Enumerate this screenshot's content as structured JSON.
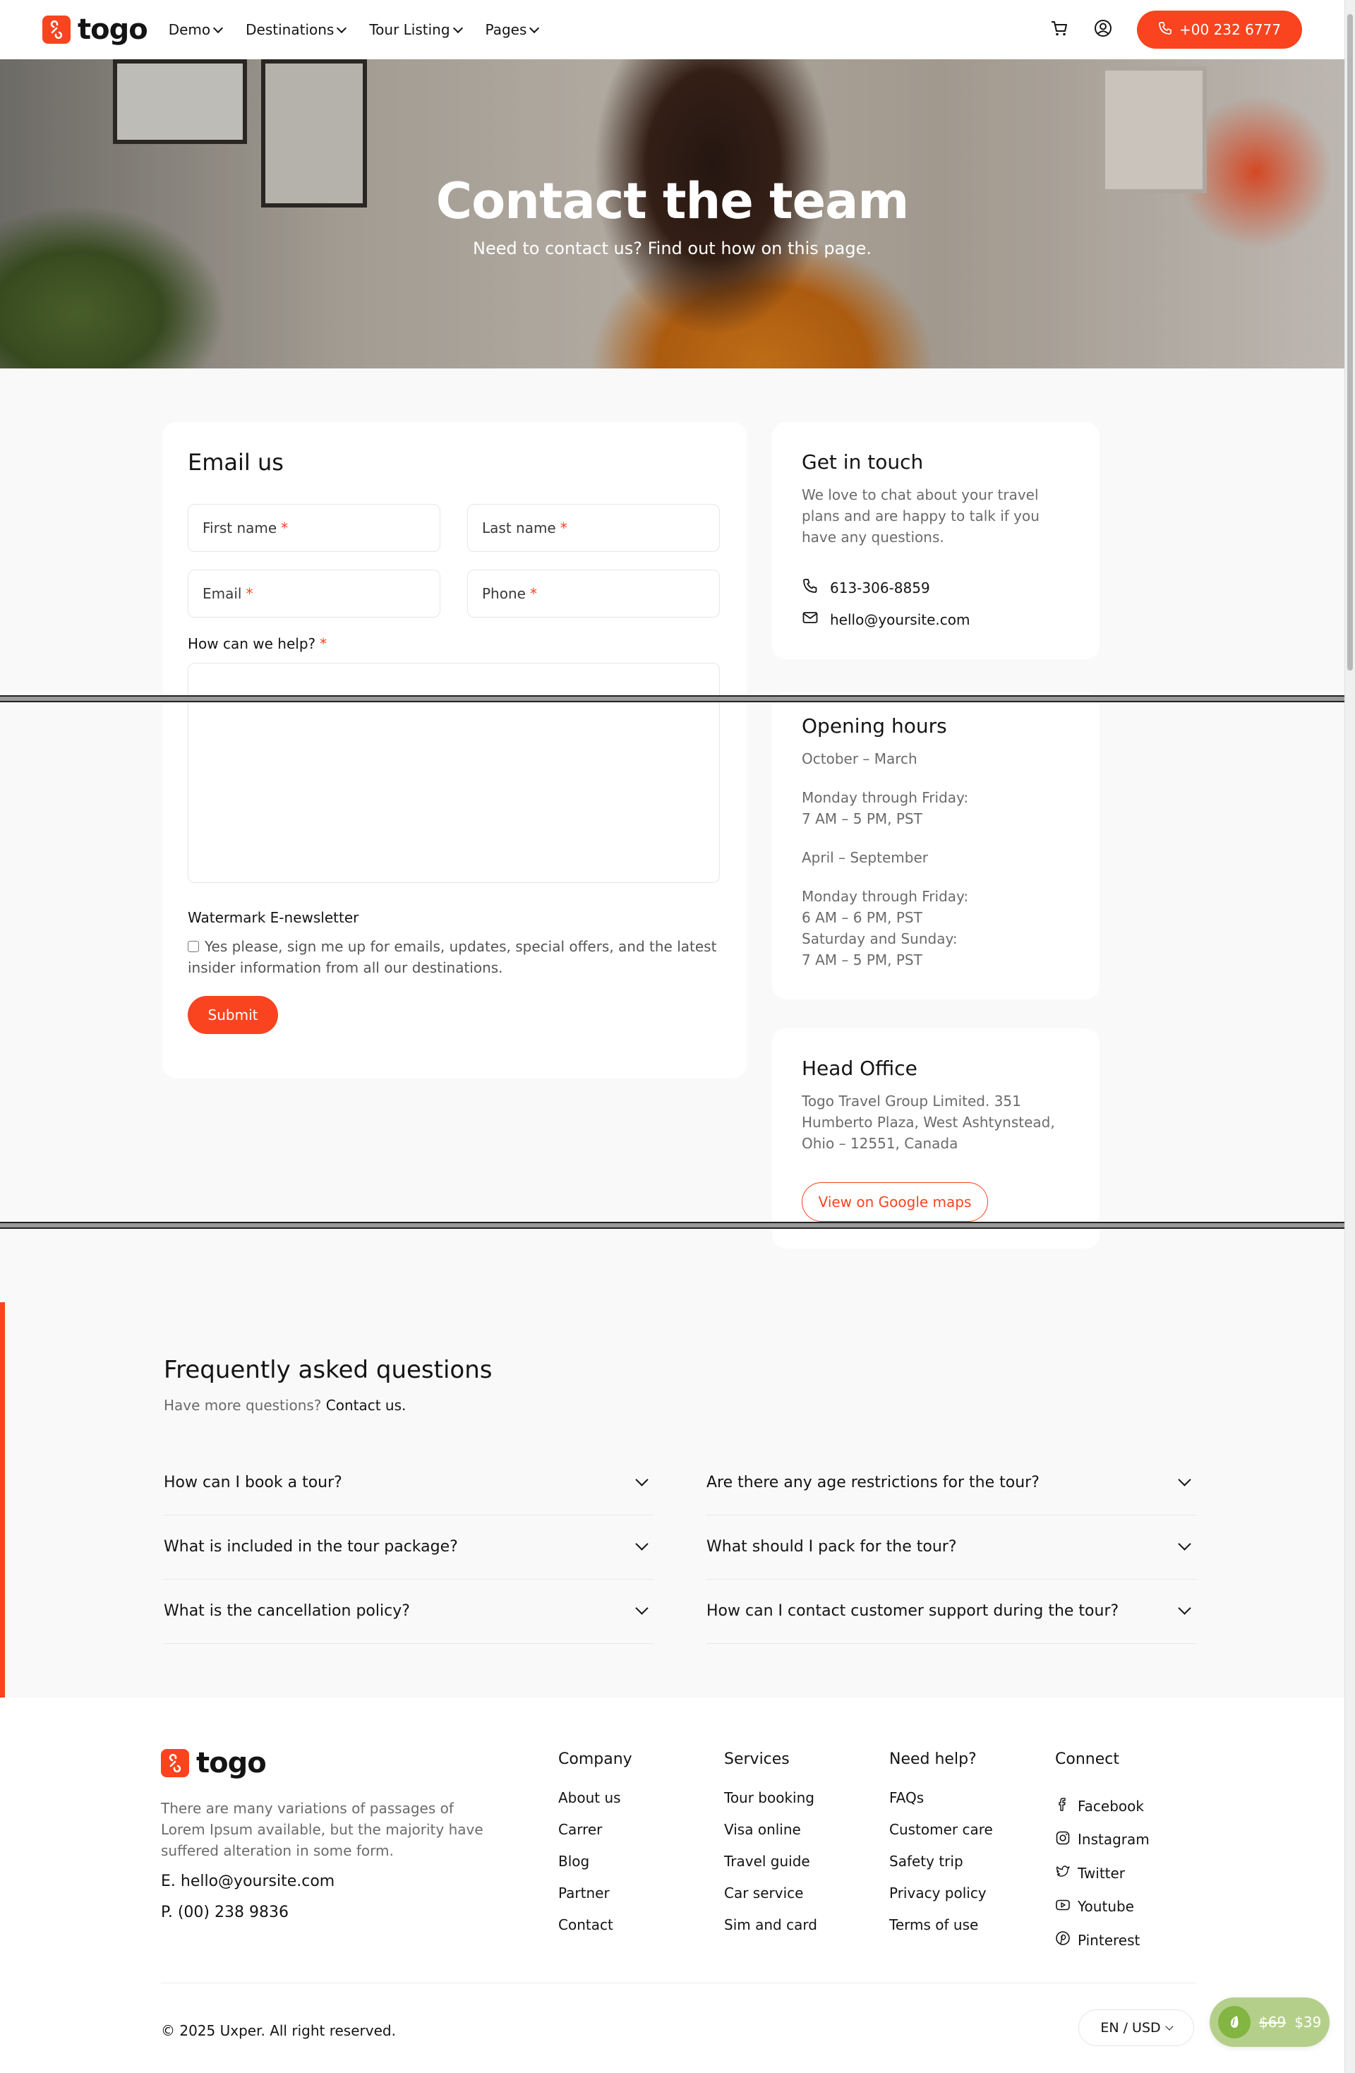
{
  "header": {
    "logo_text": "togo",
    "nav": [
      {
        "label": "Demo"
      },
      {
        "label": "Destinations"
      },
      {
        "label": "Tour Listing"
      },
      {
        "label": "Pages"
      }
    ],
    "phone_label": "+00 232 6777"
  },
  "hero": {
    "title": "Contact the team",
    "subtitle": "Need to contact us? Find out how on this page."
  },
  "email_form": {
    "title": "Email us",
    "first_name": "First name",
    "last_name": "Last name",
    "email": "Email",
    "phone": "Phone",
    "required_mark": "*",
    "help_label": "How can we help?",
    "newsletter_title": "Watermark E-newsletter",
    "newsletter_text": "Yes please, sign me up for emails, updates, special offers, and the latest insider information from all our destinations.",
    "submit": "Submit"
  },
  "get_in_touch": {
    "title": "Get in touch",
    "text": "We love to chat about your travel plans and are happy to talk if you have any questions.",
    "phone": "613-306-8859",
    "email": "hello@yoursite.com"
  },
  "opening_hours": {
    "title": "Opening hours",
    "lines": [
      "October – March",
      "Monday through Friday:",
      "7 AM – 5 PM, PST",
      "April – September",
      "Monday through Friday:",
      "6 AM – 6 PM, PST",
      "Saturday and Sunday:",
      "7 AM – 5 PM, PST"
    ]
  },
  "head_office": {
    "title": "Head Office",
    "address": "Togo Travel Group Limited. 351 Humberto Plaza, West Ashtynstead, Ohio – 12551, Canada",
    "map_button": "View on Google maps"
  },
  "faq": {
    "title": "Frequently asked questions",
    "subtitle": "Have more questions?",
    "contact_link": "Contact us.",
    "questions": [
      "How can I book a tour?",
      "Are there any age restrictions for the tour?",
      "What is included in the tour package?",
      "What should I pack for the tour?",
      "What is the cancellation policy?",
      "How can I contact customer support during the tour?"
    ]
  },
  "footer": {
    "logo_text": "togo",
    "description": "There are many variations of passages of Lorem Ipsum available, but the majority have suffered alteration in some form.",
    "email": "E. hello@yoursite.com",
    "phone": "P. (00) 238 9836",
    "columns": [
      {
        "title": "Company",
        "links": [
          "About us",
          "Carrer",
          "Blog",
          "Partner",
          "Contact"
        ]
      },
      {
        "title": "Services",
        "links": [
          "Tour booking",
          "Visa online",
          "Travel guide",
          "Car service",
          "Sim and card"
        ]
      },
      {
        "title": "Need help?",
        "links": [
          "FAQs",
          "Customer care",
          "Safety trip",
          "Privacy policy",
          "Terms of use"
        ]
      }
    ],
    "connect": {
      "title": "Connect",
      "links": [
        "Facebook",
        "Instagram",
        "Twitter",
        "Youtube",
        "Pinterest"
      ]
    },
    "copyright": "© 2025 Uxper. All right reserved.",
    "locale": "EN / USD",
    "price_old": "$69",
    "price_new": "$39"
  },
  "colors": {
    "accent": "#f9441f",
    "text": "#141414",
    "muted": "#6b6b6b",
    "bg": "#f9f9f9",
    "badge_green": "#b4cf8a"
  }
}
